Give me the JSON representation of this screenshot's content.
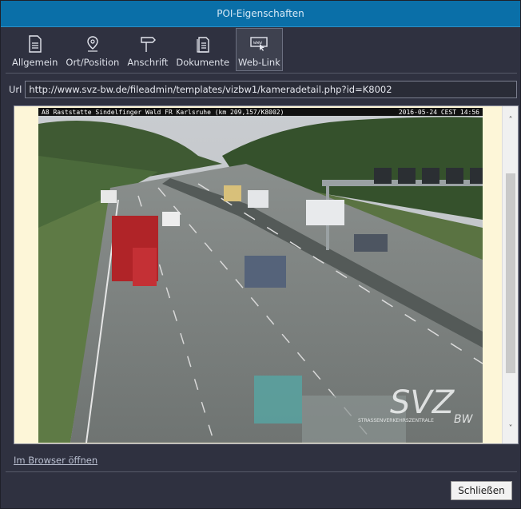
{
  "window": {
    "title": "POI-Eigenschaften"
  },
  "toolbar": {
    "items": [
      {
        "label": "Allgemein",
        "icon": "document-icon"
      },
      {
        "label": "Ort/Position",
        "icon": "location-pin-icon"
      },
      {
        "label": "Anschrift",
        "icon": "signpost-icon"
      },
      {
        "label": "Dokumente",
        "icon": "documents-icon"
      },
      {
        "label": "Web-Link",
        "icon": "web-link-icon",
        "active": true
      }
    ]
  },
  "url": {
    "label": "Url",
    "value": "http://www.svz-bw.de/fileadmin/templates/vizbw1/kameradetail.php?id=K8002"
  },
  "camera": {
    "caption_left": "A8 Raststatte Sindelfinger Wald FR Karlsruhe (km 209,157/K8002)",
    "caption_right": "2016-05-24 CEST 14:56",
    "logo_text": "SVZ",
    "logo_sub": "STRASSENVERKEHRSZENTRALE",
    "logo_bw": "BW"
  },
  "links": {
    "open_in_browser": "Im Browser öffnen"
  },
  "buttons": {
    "close": "Schließen"
  },
  "colors": {
    "titlebar": "#0a6fa8",
    "window": "#2f3140",
    "accent": "#2a90c8"
  }
}
